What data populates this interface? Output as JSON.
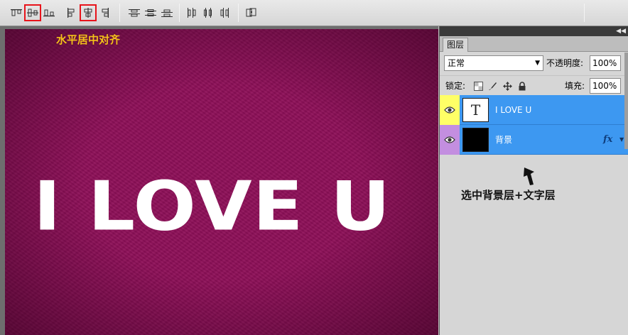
{
  "toolbar": {
    "highlight_color": "#e8141b",
    "groups": [
      [
        "align-top-edges-icon",
        "align-vertical-centers-icon",
        "align-bottom-edges-icon"
      ],
      [
        "align-left-edges-icon",
        "align-horizontal-centers-icon",
        "align-right-edges-icon"
      ],
      [
        "distribute-top-edges-icon",
        "distribute-vertical-centers-icon",
        "distribute-bottom-edges-icon"
      ],
      [
        "distribute-left-edges-icon",
        "distribute-horizontal-centers-icon",
        "distribute-right-edges-icon"
      ],
      [
        "auto-align-layers-icon"
      ]
    ],
    "highlighted": [
      "align-vertical-centers-icon",
      "align-horizontal-centers-icon"
    ]
  },
  "canvas": {
    "background_color": "#8e0f58",
    "caption": "水平居中对齐",
    "caption_color": "#f4c21b",
    "text": "I LOVE U"
  },
  "layers_panel": {
    "tab_label": "图层",
    "blend_mode": "正常",
    "opacity_label": "不透明度:",
    "opacity_value": "100%",
    "lock_label": "锁定:",
    "fill_label": "填充:",
    "fill_value": "100%",
    "selection_color": "#3d98f1",
    "layers": [
      {
        "name": "I LOVE U",
        "kind": "text",
        "thumb_glyph": "T",
        "eye_color": "#ffff66"
      },
      {
        "name": "背景",
        "kind": "background",
        "thumb_color": "#000000",
        "eye_color": "#c38ee0",
        "fx": "fx"
      }
    ]
  },
  "annotation": {
    "text": "选中背景层+文字层"
  }
}
